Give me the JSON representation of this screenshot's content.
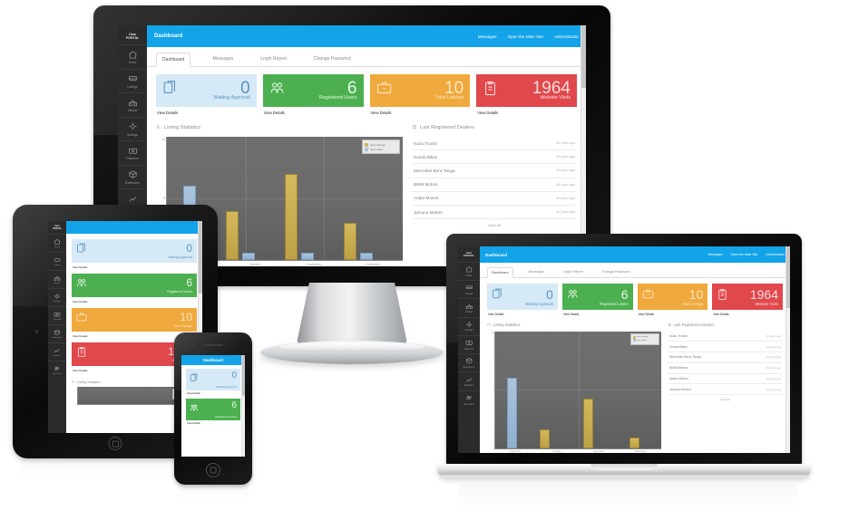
{
  "brand": {
    "line1": "Cars",
    "line2": "PORTAL"
  },
  "topbar": {
    "title": "Dashboard",
    "messages": "Messages",
    "open_site": "Open the Main Site",
    "account": "Administrator"
  },
  "sidebar": {
    "items": [
      {
        "label": "Home",
        "icon": "home-icon"
      },
      {
        "label": "Listings",
        "icon": "listings-icon"
      },
      {
        "label": "Vehicle",
        "icon": "vehicle-icon"
      },
      {
        "label": "Settings",
        "icon": "settings-icon"
      },
      {
        "label": "Payment",
        "icon": "payment-icon"
      },
      {
        "label": "Extensions",
        "icon": "extensions-icon"
      },
      {
        "label": "Statistics",
        "icon": "statistics-icon"
      },
      {
        "label": "Site Users",
        "icon": "users-icon"
      }
    ]
  },
  "tabs": [
    {
      "label": "Dashboard",
      "active": true
    },
    {
      "label": "Messages",
      "active": false
    },
    {
      "label": "Login Report",
      "active": false
    },
    {
      "label": "Change Password",
      "active": false
    }
  ],
  "cards": [
    {
      "value": "0",
      "caption": "Waiting Approval",
      "link": "View Details",
      "color": "#d6e9f7",
      "theme": "c-blue",
      "icon": "documents-icon"
    },
    {
      "value": "6",
      "caption": "Registered Users",
      "link": "View Details",
      "color": "#4cb050",
      "theme": "c-green",
      "icon": "users-group-icon"
    },
    {
      "value": "10",
      "caption": "Total Listings",
      "link": "View Details",
      "color": "#efa93c",
      "theme": "c-orange",
      "icon": "briefcase-icon"
    },
    {
      "value": "1964",
      "caption": "Website Visits",
      "link": "View Details",
      "color": "#e0484c",
      "theme": "c-red",
      "icon": "clipboard-icon"
    }
  ],
  "chart_section": {
    "title": "Listing Statistics",
    "icon": "bar-chart-icon"
  },
  "dealers_section": {
    "title": "Last Registered Dealers",
    "icon": "list-icon",
    "view_all": "View All",
    "rows": [
      {
        "name": "Isuzu Trucks",
        "time": "48 years ago"
      },
      {
        "name": "Honda Bikes",
        "time": "48 years ago"
      },
      {
        "name": "Mercedes Benz Tanga",
        "time": "48 years ago"
      },
      {
        "name": "BMW Motors",
        "time": "48 years ago"
      },
      {
        "name": "Anbar Motors",
        "time": "48 years ago"
      },
      {
        "name": "Jamuna Motors",
        "time": "48 years ago"
      }
    ]
  },
  "chart_data": {
    "type": "bar",
    "title": "Listing Statistics",
    "xlabel": "",
    "ylabel": "",
    "categories": [
      "September",
      "October",
      "November",
      "December"
    ],
    "series": [
      {
        "name": "New Listings",
        "color": "#d4b95a",
        "values": [
          0,
          4,
          7,
          3
        ]
      },
      {
        "name": "New Users",
        "color": "#a9c4dd",
        "values": [
          6,
          0.6,
          0.6,
          0.6
        ]
      }
    ],
    "ylim": [
      0,
      10
    ],
    "yticks": [
      0,
      5,
      10
    ],
    "grid": true,
    "legend_position": "top-right",
    "plot_background": "#6a6a6a"
  },
  "theme": {
    "accent": "#13a3e8",
    "sidebar": "#2b2b2b",
    "card_blue": "#d6e9f7",
    "card_green": "#4cb050",
    "card_orange": "#efa93c",
    "card_red": "#e0484c",
    "bar_gold": "#d4b95a",
    "bar_blue": "#a9c4dd"
  },
  "devices": [
    {
      "name": "desktop-monitor"
    },
    {
      "name": "laptop"
    },
    {
      "name": "tablet"
    },
    {
      "name": "smartphone"
    }
  ]
}
